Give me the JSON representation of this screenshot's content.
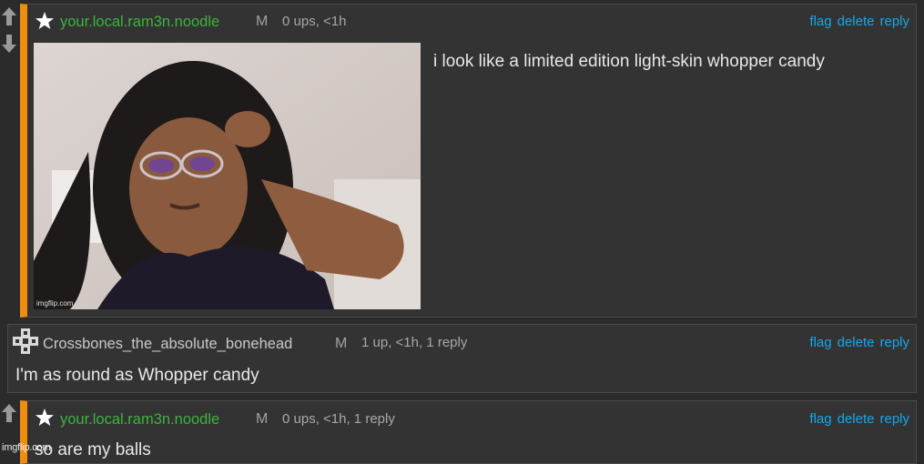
{
  "comments": [
    {
      "username": "your.local.ram3n.noodle",
      "gender": "M",
      "meta": "0 ups, <1h",
      "actions": [
        "flag",
        "delete",
        "reply"
      ],
      "text": "i look like a limited edition light-skin whopper candy",
      "image_watermark": "imgflip.com",
      "image_alt": "selfie photo"
    },
    {
      "username": "Crossbones_the_absolute_bonehead",
      "gender": "M",
      "meta": "1 up, <1h, 1 reply",
      "actions": [
        "flag",
        "delete",
        "reply"
      ],
      "text": "I'm as round as Whopper candy"
    },
    {
      "username": "your.local.ram3n.noodle",
      "gender": "M",
      "meta": "0 ups, <1h, 1 reply",
      "actions": [
        "flag",
        "delete",
        "reply"
      ],
      "text": "so are my balls"
    }
  ],
  "page_watermark": "imgflip.com",
  "colors": {
    "accent": "#f08c10",
    "link": "#16a8ea",
    "username": "#3cb43c",
    "background": "#2b2b2b",
    "panel": "#333333"
  },
  "icons": [
    "upvote-arrow-icon",
    "downvote-arrow-icon",
    "star-icon",
    "user-icon"
  ]
}
